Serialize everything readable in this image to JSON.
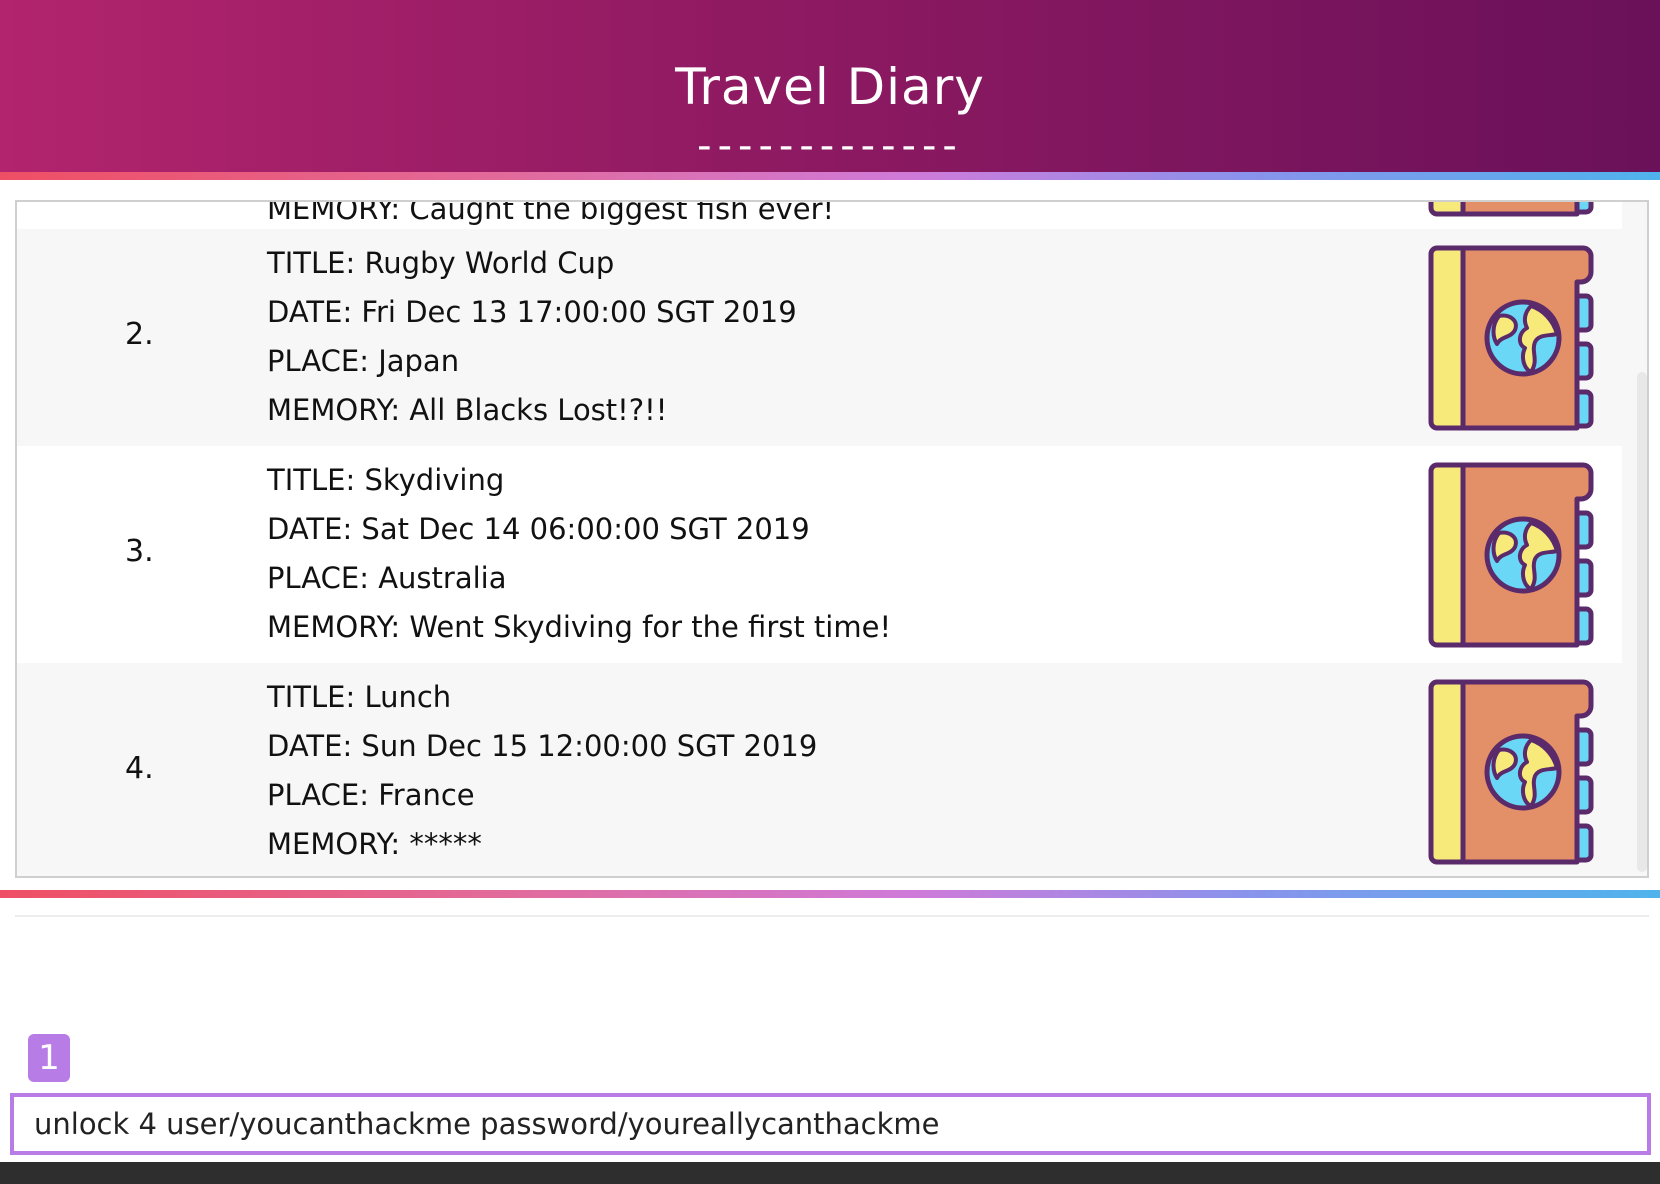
{
  "header": {
    "title": "Travel Diary",
    "dashes": "-------------"
  },
  "entries": [
    {
      "index": "",
      "title": "",
      "date": "",
      "place": "",
      "memory": "MEMORY: Caught the biggest fish ever!"
    },
    {
      "index": "2.",
      "title": "TITLE: Rugby World Cup",
      "date": "DATE: Fri Dec 13 17:00:00 SGT 2019",
      "place": "PLACE: Japan",
      "memory": "MEMORY: All Blacks Lost!?!!"
    },
    {
      "index": "3.",
      "title": "TITLE: Skydiving",
      "date": "DATE: Sat Dec 14 06:00:00 SGT 2019",
      "place": "PLACE: Australia",
      "memory": "MEMORY: Went Skydiving for the first time!"
    },
    {
      "index": "4.",
      "title": "TITLE: Lunch",
      "date": "DATE: Sun Dec 15 12:00:00 SGT 2019",
      "place": "PLACE: France",
      "memory": "MEMORY: *****"
    }
  ],
  "result_box": {
    "text": ""
  },
  "badge": {
    "label": "1"
  },
  "command_box": {
    "value": "unlock 4 user/youcanthackme password/youreallycanthackme"
  },
  "colors": {
    "header_start": "#b2246d",
    "header_end": "#6a115a",
    "accent_purple": "#b77ce6",
    "book_cover": "#e38f67",
    "book_spine": "#f7ea7a",
    "book_tabs": "#6ad7f7",
    "book_outline": "#5b2a6a"
  },
  "icons": {
    "entry_icon": "travel-diary-book-globe-icon"
  }
}
